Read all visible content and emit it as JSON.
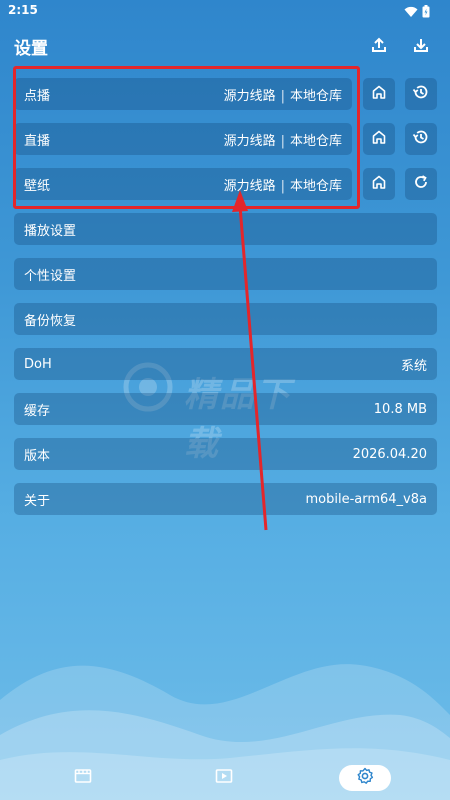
{
  "status_bar": {
    "time": "2:15",
    "icons": [
      "wifi-icon",
      "battery-icon"
    ]
  },
  "header": {
    "title": "设置",
    "upload_icon": "upload-icon",
    "download_icon": "download-icon"
  },
  "source_rows": [
    {
      "label": "点播",
      "value_a": "源力线路",
      "sep": "|",
      "value_b": "本地仓库",
      "home_icon": "home-icon",
      "action_icon": "history-icon"
    },
    {
      "label": "直播",
      "value_a": "源力线路",
      "sep": "|",
      "value_b": "本地仓库",
      "home_icon": "home-icon",
      "action_icon": "history-icon"
    },
    {
      "label": "壁纸",
      "value_a": "源力线路",
      "sep": "|",
      "value_b": "本地仓库",
      "home_icon": "home-icon",
      "action_icon": "refresh-icon"
    }
  ],
  "setting_rows": [
    {
      "label": "播放设置",
      "value": ""
    },
    {
      "label": "个性设置",
      "value": ""
    },
    {
      "label": "备份恢复",
      "value": ""
    },
    {
      "label": "DoH",
      "value": "系统"
    },
    {
      "label": "缓存",
      "value": "10.8 MB"
    },
    {
      "label": "版本",
      "value": "2026.04.20"
    },
    {
      "label": "关于",
      "value": "mobile-arm64_v8a"
    }
  ],
  "watermark": {
    "text": "精品下载"
  },
  "bottom_nav": [
    {
      "icon": "film-icon",
      "active": false
    },
    {
      "icon": "play-icon",
      "active": false
    },
    {
      "icon": "gear-icon",
      "active": true
    }
  ],
  "colors": {
    "highlight": "#e3262b",
    "active_nav_bg": "#ffffff",
    "active_icon": "#2f86cc"
  }
}
